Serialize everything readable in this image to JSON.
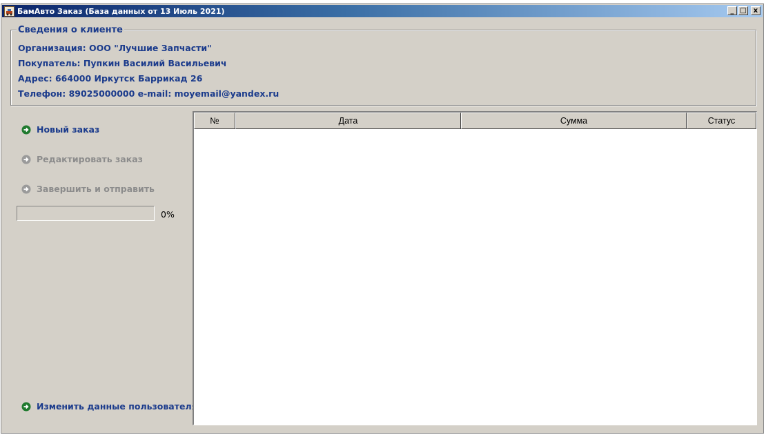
{
  "window": {
    "title": "БамАвто Заказ (База данных от 13 Июль 2021)",
    "controls": {
      "minimize": "_",
      "maximize": "□",
      "close": "x"
    }
  },
  "client_info": {
    "legend": "Сведения о клиенте",
    "organization": "Организация: ООО \"Лучшие Запчасти\"",
    "buyer": "Покупатель: Пупкин Василий Васильевич",
    "address": "Адрес: 664000 Иркутск Баррикад 26",
    "phone": "Телефон: 89025000000 e-mail: moyemail@yandex.ru"
  },
  "actions": {
    "new_order": "Новый заказ",
    "edit_order": "Редактировать заказ",
    "finish_send": "Завершить и отправить",
    "change_user": "Изменить данные пользователя"
  },
  "progress": {
    "value": 0,
    "label": "0%"
  },
  "orders_table": {
    "columns": [
      "№",
      "Дата",
      "Сумма",
      "Статус"
    ],
    "rows": []
  },
  "colors": {
    "accent": "#1b3b8c",
    "icon_green": "#1f7a2e",
    "disabled": "#8c8c8c",
    "face": "#d4d0c8"
  }
}
